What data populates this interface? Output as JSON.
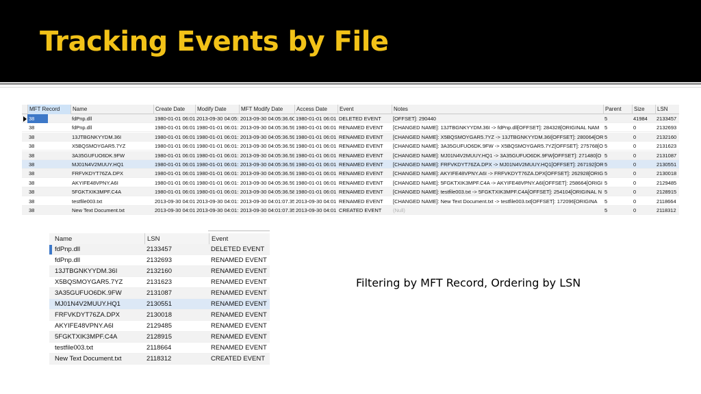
{
  "title": "Tracking Events by File",
  "caption": "Filtering by MFT Record, Ordering by LSN",
  "colors": {
    "title": "#f2c218",
    "header_bg": "#000000",
    "selection": "#3d78c8"
  },
  "grid1": {
    "columns": [
      "MFT Record",
      "Name",
      "Create Date",
      "Modify Date",
      "MFT Modify Date",
      "Access Date",
      "Event",
      "Notes",
      "Parent",
      "Size",
      "LSN"
    ],
    "rows": [
      [
        "38",
        "fdPnp.dll",
        "1980-01-01 06:01",
        "2013-09-30 04:05:",
        "2013-09-30 04:05:36.60",
        "1980-01-01 06:01",
        "DELETED EVENT",
        "[OFFSET]: 290440",
        "5",
        "41984",
        "2133457"
      ],
      [
        "38",
        "fdPnp.dll",
        "1980-01-01 06:01",
        "1980-01-01 06:01:",
        "2013-09-30 04:05:36.59",
        "1980-01-01 06:01",
        "RENAMED EVENT",
        "[CHANGED NAME]: 13JTBGNKYYDM.36I -> fdPnp.dll[OFFSET]: 284328[ORIGINAL NAM",
        "5",
        "0",
        "2132693"
      ],
      [
        "38",
        "13JTBGNKYYDM.36I",
        "1980-01-01 06:01",
        "1980-01-01 06:01:",
        "2013-09-30 04:05:36.59",
        "1980-01-01 06:01",
        "RENAMED EVENT",
        "[CHANGED NAME]: X5BQSMOYGAR5.7YZ -> 13JTBGNKYYDM.36I[OFFSET]: 280064[ORI",
        "5",
        "0",
        "2132160"
      ],
      [
        "38",
        "X5BQSMOYGAR5.7YZ",
        "1980-01-01 06:01",
        "1980-01-01 06:01:",
        "2013-09-30 04:05:36.59",
        "1980-01-01 06:01",
        "RENAMED EVENT",
        "[CHANGED NAME]: 3A35GUFUO6DK.9FW -> X5BQSMOYGAR5.7YZ[OFFSET]: 275768[OI",
        "5",
        "0",
        "2131623"
      ],
      [
        "38",
        "3A35GUFUO6DK.9FW",
        "1980-01-01 06:01",
        "1980-01-01 06:01:",
        "2013-09-30 04:05:36.59",
        "1980-01-01 06:01",
        "RENAMED EVENT",
        "[CHANGED NAME]: MJ01N4V2MUUY.HQ1 -> 3A35GUFUO6DK.9FW[OFFSET]: 271480[O",
        "5",
        "0",
        "2131087"
      ],
      [
        "38",
        "MJ01N4V2MUUY.HQ1",
        "1980-01-01 06:01",
        "1980-01-01 06:01:",
        "2013-09-30 04:05:36.59",
        "1980-01-01 06:01",
        "RENAMED EVENT",
        "[CHANGED NAME]: FRFVKDYT76ZA.DPX -> MJ01N4V2MUUY.HQ1[OFFSET]: 267192[OR",
        "5",
        "0",
        "2130551"
      ],
      [
        "38",
        "FRFVKDYT76ZA.DPX",
        "1980-01-01 06:01",
        "1980-01-01 06:01:",
        "2013-09-30 04:05:36.59",
        "1980-01-01 06:01",
        "RENAMED EVENT",
        "[CHANGED NAME]: AKYIFE48VPNY.A6I -> FRFVKDYT76ZA.DPX[OFFSET]: 262928[ORIGI",
        "5",
        "0",
        "2130018"
      ],
      [
        "38",
        "AKYIFE48VPNY.A6I",
        "1980-01-01 06:01",
        "1980-01-01 06:01:",
        "2013-09-30 04:05:36.59",
        "1980-01-01 06:01",
        "RENAMED EVENT",
        "[CHANGED NAME]: 5FGKTXIK3MPF.C4A -> AKYIFE48VPNY.A6I[OFFSET]: 258664[ORIGI",
        "5",
        "0",
        "2129485"
      ],
      [
        "38",
        "5FGKTXIK3MPF.C4A",
        "1980-01-01 06:01",
        "1980-01-01 06:01:",
        "2013-09-30 04:05:36.58",
        "1980-01-01 06:01",
        "RENAMED EVENT",
        "[CHANGED NAME]: testfile003.txt -> 5FGKTXIK3MPF.C4A[OFFSET]: 254104[ORIGINAL N",
        "5",
        "0",
        "2128915"
      ],
      [
        "38",
        "testfile003.txt",
        "2013-09-30 04:01",
        "2013-09-30 04:01:",
        "2013-09-30 04:01:07.35",
        "2013-09-30 04:01",
        "RENAMED EVENT",
        "[CHANGED NAME]: New Text Document.txt -> testfile003.txt[OFFSET]: 172096[ORIGINA",
        "5",
        "0",
        "2118664"
      ],
      [
        "38",
        "New Text Document.txt",
        "2013-09-30 04:01",
        "2013-09-30 04:01:",
        "2013-09-30 04:01:07.35",
        "2013-09-30 04:01",
        "CREATED EVENT",
        "(Null)",
        "5",
        "0",
        "2118312"
      ]
    ]
  },
  "grid2": {
    "columns": [
      "Name",
      "LSN",
      "Event"
    ],
    "rows": [
      [
        "fdPnp.dll",
        "2133457",
        "DELETED EVENT"
      ],
      [
        "fdPnp.dll",
        "2132693",
        "RENAMED EVENT"
      ],
      [
        "13JTBGNKYYDM.36I",
        "2132160",
        "RENAMED EVENT"
      ],
      [
        "X5BQSMOYGAR5.7YZ",
        "2131623",
        "RENAMED EVENT"
      ],
      [
        "3A35GUFUO6DK.9FW",
        "2131087",
        "RENAMED EVENT"
      ],
      [
        "MJ01N4V2MUUY.HQ1",
        "2130551",
        "RENAMED EVENT"
      ],
      [
        "FRFVKDYT76ZA.DPX",
        "2130018",
        "RENAMED EVENT"
      ],
      [
        "AKYIFE48VPNY.A6I",
        "2129485",
        "RENAMED EVENT"
      ],
      [
        "5FGKTXIK3MPF.C4A",
        "2128915",
        "RENAMED EVENT"
      ],
      [
        "testfile003.txt",
        "2118664",
        "RENAMED EVENT"
      ],
      [
        "New Text Document.txt",
        "2118312",
        "CREATED EVENT"
      ]
    ]
  }
}
